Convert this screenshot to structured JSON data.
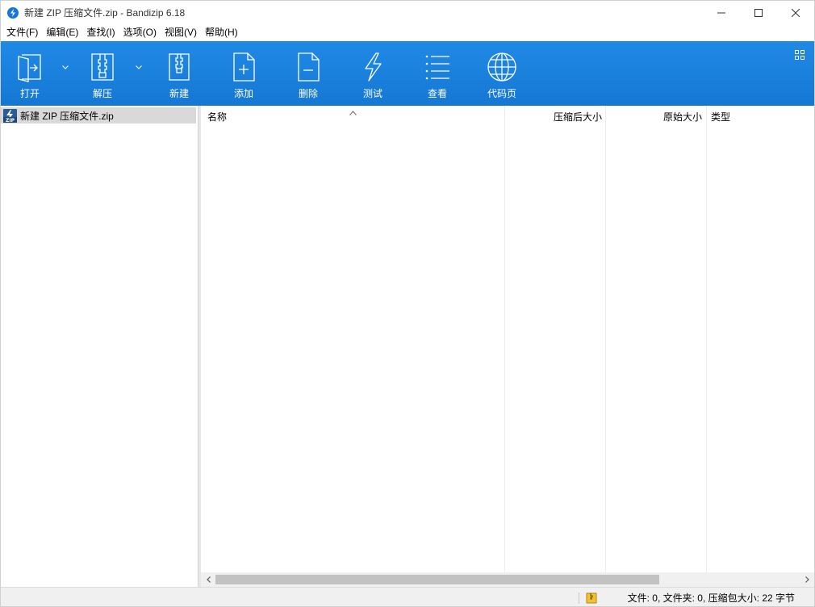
{
  "window": {
    "title": "新建 ZIP 压缩文件.zip - Bandizip 6.18"
  },
  "menu": {
    "items": [
      {
        "name": "menu-file",
        "label": "文件(F)"
      },
      {
        "name": "menu-edit",
        "label": "编辑(E)"
      },
      {
        "name": "menu-find",
        "label": "查找(I)"
      },
      {
        "name": "menu-options",
        "label": "选项(O)"
      },
      {
        "name": "menu-view",
        "label": "视图(V)"
      },
      {
        "name": "menu-help",
        "label": "帮助(H)"
      }
    ]
  },
  "toolbar": {
    "open_label": "打开",
    "extract_label": "解压",
    "new_label": "新建",
    "add_label": "添加",
    "delete_label": "删除",
    "test_label": "测试",
    "view_label": "查看",
    "codepage_label": "代码页"
  },
  "tree": {
    "root_label": "新建 ZIP 压缩文件.zip"
  },
  "list": {
    "columns": {
      "name": "名称",
      "compressed_size": "压缩后大小",
      "original_size": "原始大小",
      "type": "类型"
    },
    "sort_column": "name"
  },
  "status": {
    "summary": "文件: 0, 文件夹: 0, 压缩包大小: 22 字节"
  },
  "colors": {
    "toolbar_blue": "#1a80dd",
    "selection_gray": "#d9d9d9"
  }
}
